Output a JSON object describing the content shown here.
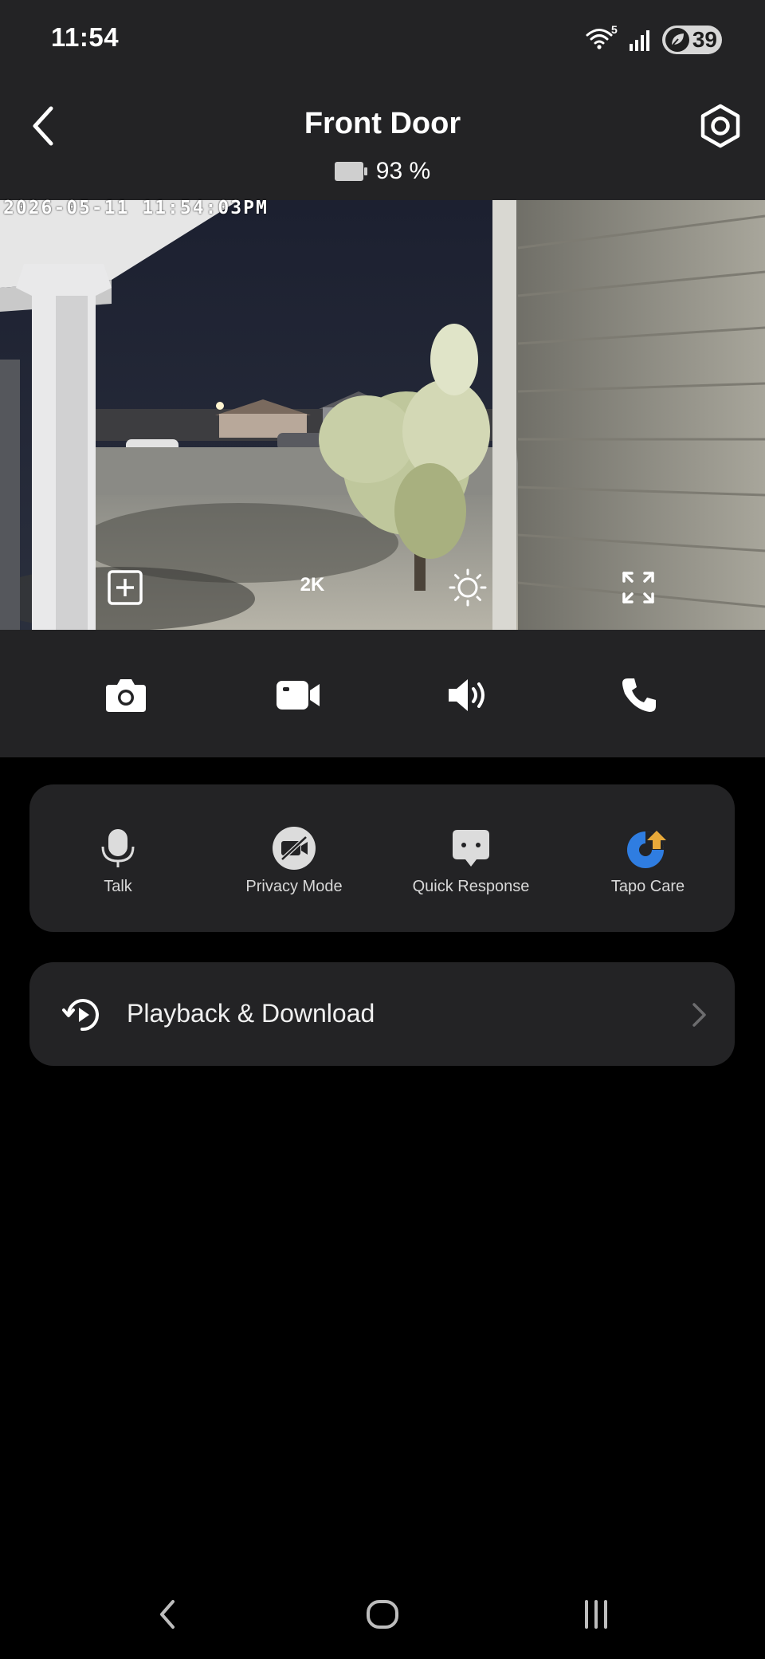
{
  "status_bar": {
    "time": "11:54",
    "wifi_badge": "5",
    "battery_level": "39",
    "icons": [
      "wifi-icon",
      "signal-icon",
      "battery-saver-icon"
    ]
  },
  "header": {
    "title": "Front Door",
    "battery_percent": "93 %",
    "back_icon": "chevron-left-icon",
    "settings_icon": "hex-nut-settings-icon"
  },
  "video": {
    "timestamp": "2026-05-11 11:54:03PM",
    "quality": "2K",
    "overlay_icons": [
      "add-view-icon",
      "brightness-icon",
      "fullscreen-icon"
    ]
  },
  "controls": {
    "icons": [
      "camera-icon",
      "video-record-icon",
      "speaker-icon",
      "phone-icon"
    ]
  },
  "actions": [
    {
      "label": "Talk",
      "icon": "microphone-icon"
    },
    {
      "label": "Privacy Mode",
      "icon": "privacy-mode-icon"
    },
    {
      "label": "Quick Response",
      "icon": "quick-response-icon"
    },
    {
      "label": "Tapo Care",
      "icon": "tapo-care-icon"
    }
  ],
  "playback": {
    "label": "Playback & Download",
    "icon": "playback-history-icon"
  },
  "nav_bar": {
    "icons": [
      "nav-back-icon",
      "nav-home-icon",
      "nav-recents-icon"
    ]
  },
  "colors": {
    "header_bg": "#232325",
    "page_bg": "#000000",
    "card_bg": "#232325",
    "tapo_blue": "#2f7de1",
    "tapo_gold": "#e8a93a"
  }
}
